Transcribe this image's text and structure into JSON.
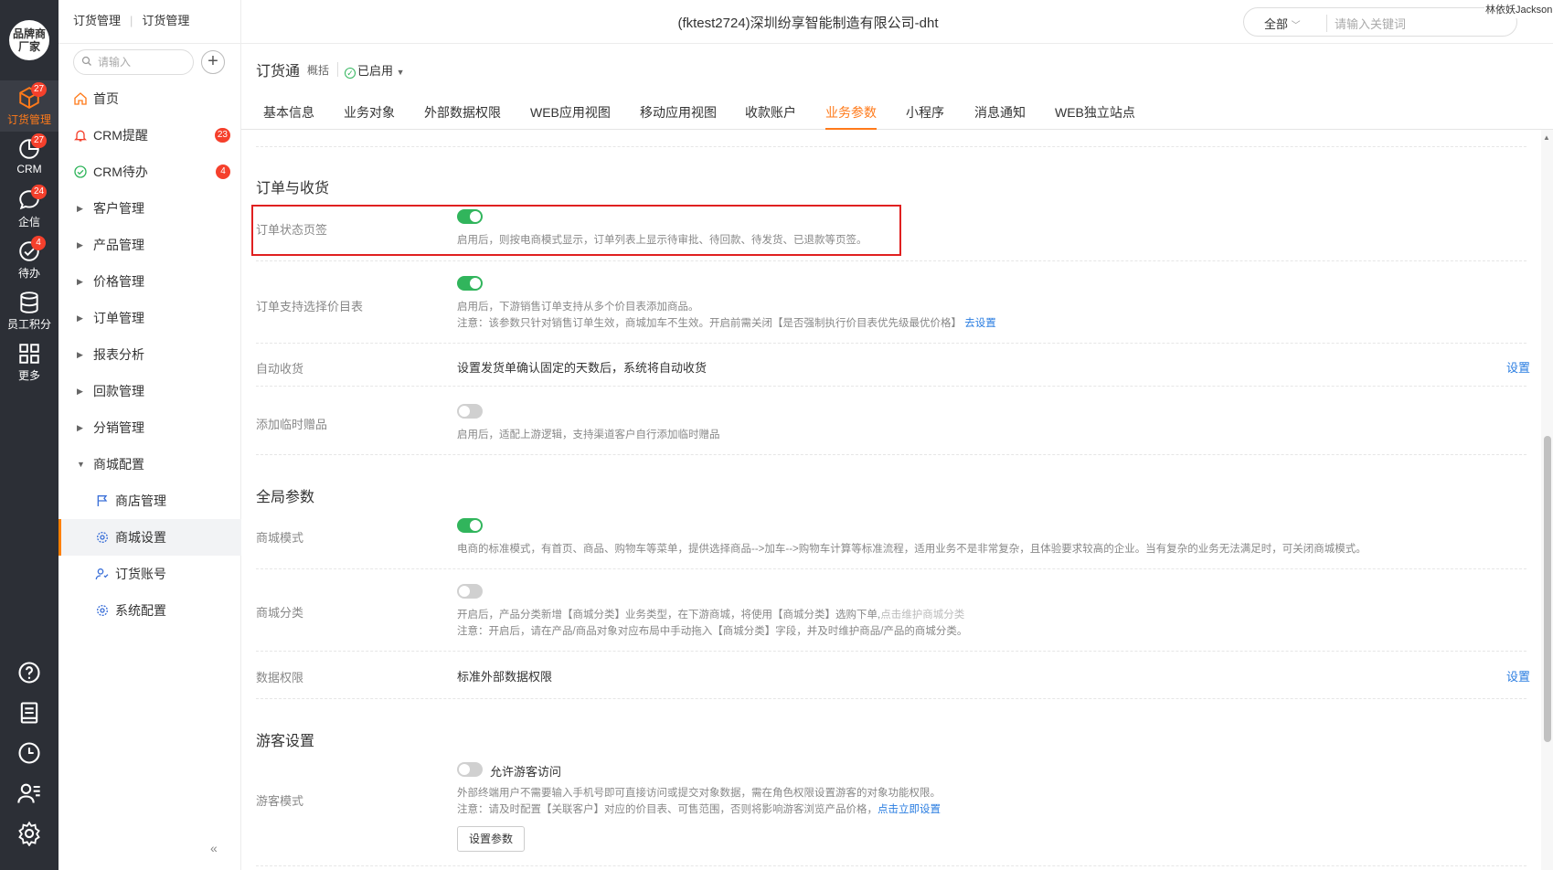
{
  "rail": {
    "brand": "品牌商厂家",
    "items": [
      {
        "label": "订货管理",
        "badge": "27",
        "icon": "box-icon",
        "active": true
      },
      {
        "label": "CRM",
        "badge": "27",
        "icon": "chart-pie-icon"
      },
      {
        "label": "企信",
        "badge": "24",
        "icon": "chat-bubble-icon"
      },
      {
        "label": "待办",
        "badge": "4",
        "icon": "check-circle-icon"
      },
      {
        "label": "员工积分",
        "icon": "database-icon"
      },
      {
        "label": "更多",
        "icon": "grid-icon"
      }
    ],
    "bottom_icons": [
      "help-icon",
      "notebook-icon",
      "clock-icon",
      "contacts-icon",
      "settings-icon"
    ]
  },
  "sidebar": {
    "header_left": "订货管理",
    "header_right": "订货管理",
    "search_placeholder": "请输入",
    "items": [
      {
        "label": "首页",
        "icon": "home-icon"
      },
      {
        "label": "CRM提醒",
        "icon": "bell-icon",
        "badge": "23"
      },
      {
        "label": "CRM待办",
        "icon": "check-icon",
        "badge": "4"
      },
      {
        "label": "客户管理"
      },
      {
        "label": "产品管理"
      },
      {
        "label": "价格管理"
      },
      {
        "label": "订单管理"
      },
      {
        "label": "报表分析"
      },
      {
        "label": "回款管理"
      },
      {
        "label": "分销管理"
      },
      {
        "label": "商城配置",
        "expanded": true
      },
      {
        "label": "商店管理",
        "icon": "flag-icon",
        "sub": true
      },
      {
        "label": "商城设置",
        "icon": "gear-icon",
        "sub": true,
        "active": true
      },
      {
        "label": "订货账号",
        "icon": "user-group-icon",
        "sub": true
      },
      {
        "label": "系统配置",
        "icon": "gear-icon",
        "sub": true
      }
    ]
  },
  "topbar": {
    "company": "(fktest2724)深圳纷享智能制造有限公司-dht",
    "search_scope": "全部",
    "search_placeholder": "请输入关键词",
    "user_name": "林依妖Jackson"
  },
  "app": {
    "title": "订货通",
    "overview": "概括",
    "status": "已启用"
  },
  "tabs": [
    "基本信息",
    "业务对象",
    "外部数据权限",
    "WEB应用视图",
    "移动应用视图",
    "收款账户",
    "业务参数",
    "小程序",
    "消息通知",
    "WEB独立站点"
  ],
  "active_tab": "业务参数",
  "sections": {
    "order": {
      "title": "订单与收货",
      "tab_label": "订单状态页签",
      "tab_toggle": true,
      "tab_desc": "启用后，则按电商模式显示，订单列表上显示待审批、待回款、待发货、已退款等页签。",
      "price_label": "订单支持选择价目表",
      "price_toggle": true,
      "price_desc1": "启用后，下游销售订单支持从多个价目表添加商品。",
      "price_desc2": "注意：该参数只针对销售订单生效，商城加车不生效。开启前需关闭【是否强制执行价目表优先级最优价格】",
      "price_link": "去设置",
      "auto_label": "自动收货",
      "auto_value": "设置发货单确认固定的天数后，系统将自动收货",
      "auto_link": "设置",
      "gift_label": "添加临时赠品",
      "gift_toggle": false,
      "gift_desc": "启用后，适配上游逻辑，支持渠道客户自行添加临时赠品"
    },
    "global": {
      "title": "全局参数",
      "mall_label": "商城模式",
      "mall_toggle": true,
      "mall_desc": "电商的标准模式，有首页、商品、购物车等菜单，提供选择商品-->加车-->购物车计算等标准流程，适用业务不是非常复杂，且体验要求较高的企业。当有复杂的业务无法满足时，可关闭商城模式。",
      "cat_label": "商城分类",
      "cat_toggle": false,
      "cat_desc1": "开启后，产品分类新增【商城分类】业务类型，在下游商城，将使用【商城分类】选购下单,",
      "cat_link": "点击维护商城分类",
      "cat_desc2": "注意：开启后，请在产品/商品对象对应布局中手动拖入【商城分类】字段，并及时维护商品/产品的商城分类。",
      "perm_label": "数据权限",
      "perm_value": "标准外部数据权限",
      "perm_link": "设置"
    },
    "guest": {
      "title": "游客设置",
      "mode_label": "游客模式",
      "allow_toggle": false,
      "allow_label": "允许游客访问",
      "desc1": "外部终端用户不需要输入手机号即可直接访问或提交对象数据，需在角色权限设置游客的对象功能权限。",
      "desc2": "注意：请及时配置【关联客户】对应的价目表、可售范围，否则将影响游客浏览产品价格，",
      "link": "点击立即设置",
      "button": "设置参数"
    }
  },
  "colors": {
    "accent": "#ff7a1a",
    "toggle_on": "#31b55c",
    "link": "#2a7de1",
    "badge": "#f5402c",
    "rail_bg": "#2c2f36",
    "highlight_box": "#e02020"
  }
}
